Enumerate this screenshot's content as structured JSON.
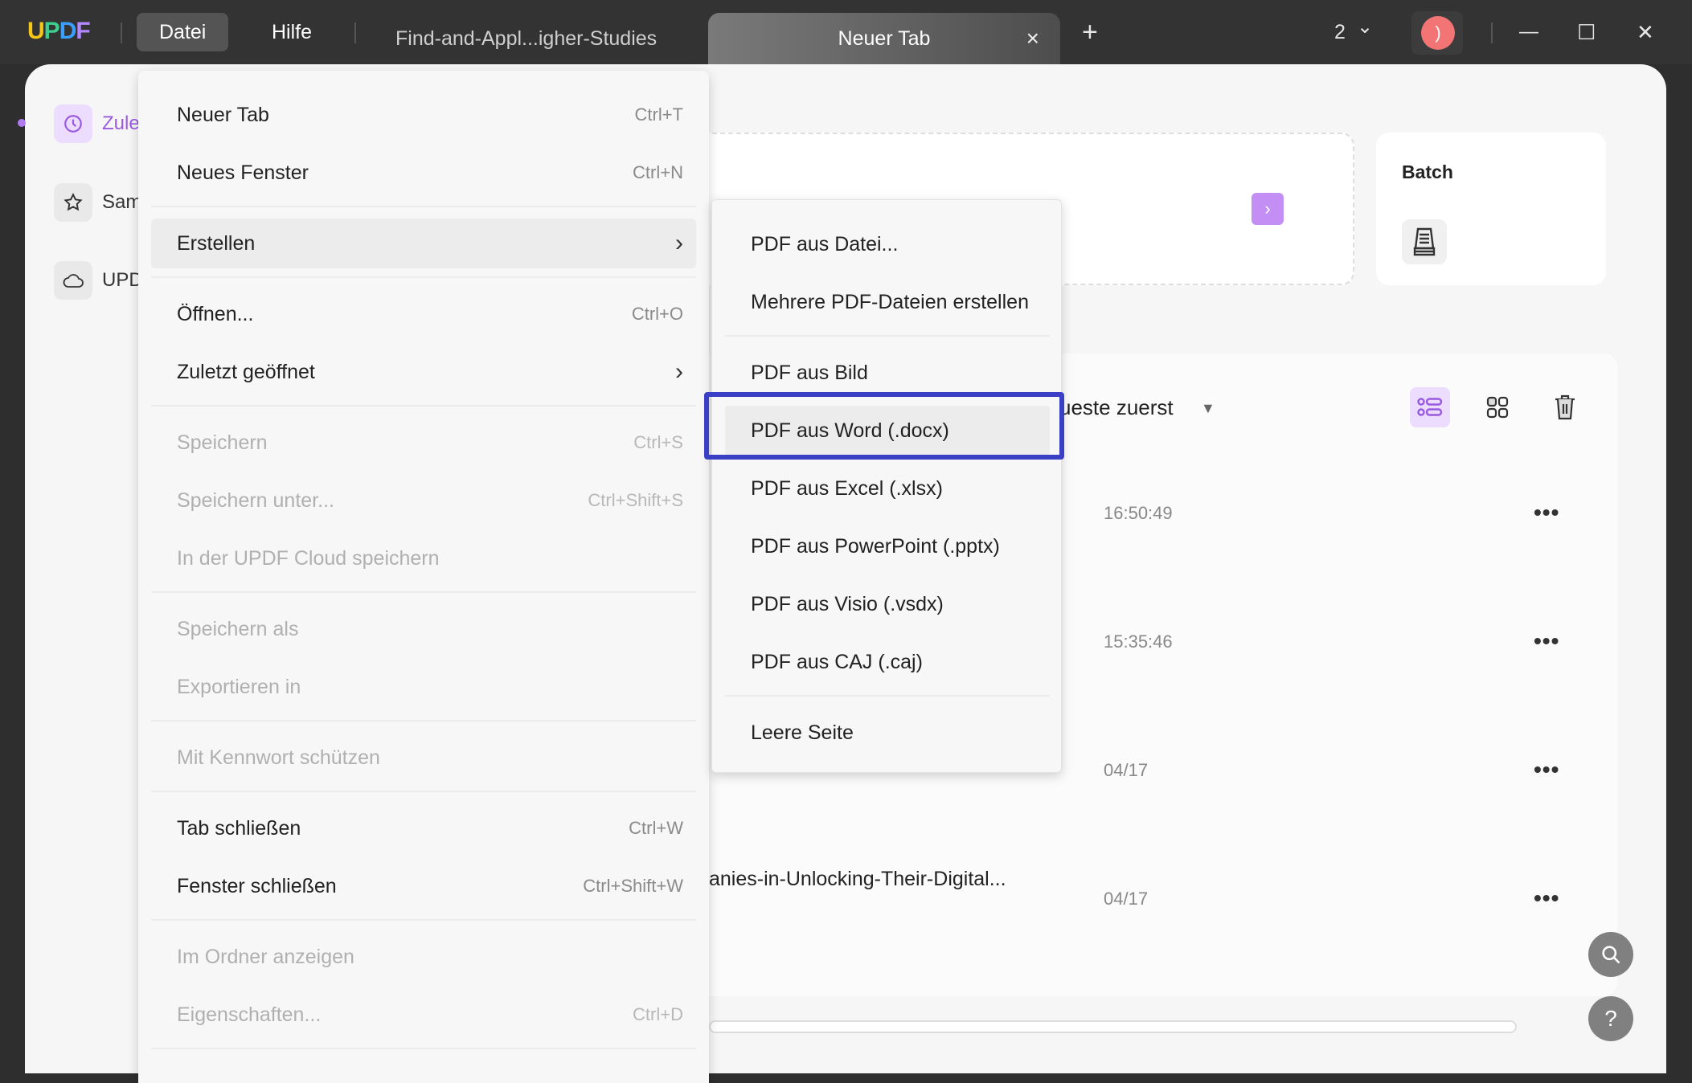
{
  "app": {
    "logo": [
      "U",
      "P",
      "D",
      "F"
    ],
    "menubar": {
      "file": "Datei",
      "help": "Hilfe"
    },
    "tabs": [
      {
        "label": "Find-and-Appl...igher-Studies",
        "active": false
      },
      {
        "label": "Neuer Tab",
        "active": true
      }
    ],
    "tab_close_icon": "×",
    "new_tab_icon": "+",
    "window_count": "2",
    "window_count_chevron": "⌄",
    "avatar_initial": ")",
    "window_controls": {
      "minimize": "—",
      "maximize": "☐",
      "close": "✕"
    }
  },
  "sidebar": {
    "items": [
      {
        "label": "Zule",
        "icon": "clock-icon",
        "active": true
      },
      {
        "label": "Sam",
        "icon": "star-icon",
        "active": false
      },
      {
        "label": "UPD",
        "icon": "cloud-icon",
        "active": false
      }
    ]
  },
  "main": {
    "upload_arrow": "›",
    "batch": {
      "title": "Batch"
    },
    "sort": {
      "label": "ueste zuerst",
      "caret": "▼"
    },
    "files": [
      {
        "name": "",
        "time": "16:50:49",
        "more": "•••"
      },
      {
        "name": "",
        "time": "15:35:46",
        "more": "•••"
      },
      {
        "name": "",
        "time": "04/17",
        "more": "•••"
      },
      {
        "name": "anies-in-Unlocking-Their-Digital...",
        "time": "04/17",
        "more": "•••"
      }
    ],
    "fab_search": "⌕",
    "fab_help": "?"
  },
  "file_menu": {
    "items": [
      {
        "label": "Neuer Tab",
        "shortcut": "Ctrl+T",
        "disabled": false
      },
      {
        "label": "Neues Fenster",
        "shortcut": "Ctrl+N",
        "disabled": false
      },
      {
        "label": "Erstellen",
        "shortcut": "",
        "submenu": true,
        "disabled": false
      },
      {
        "label": "Öffnen...",
        "shortcut": "Ctrl+O",
        "disabled": false
      },
      {
        "label": "Zuletzt geöffnet",
        "shortcut": "",
        "submenu": true,
        "disabled": false
      },
      {
        "label": "Speichern",
        "shortcut": "Ctrl+S",
        "disabled": true
      },
      {
        "label": "Speichern unter...",
        "shortcut": "Ctrl+Shift+S",
        "disabled": true
      },
      {
        "label": "In der UPDF Cloud speichern",
        "shortcut": "",
        "disabled": true
      },
      {
        "label": "Speichern als",
        "shortcut": "",
        "disabled": true
      },
      {
        "label": "Exportieren in",
        "shortcut": "",
        "disabled": true
      },
      {
        "label": "Mit Kennwort schützen",
        "shortcut": "",
        "disabled": true
      },
      {
        "label": "Tab schließen",
        "shortcut": "Ctrl+W",
        "disabled": false
      },
      {
        "label": "Fenster schließen",
        "shortcut": "Ctrl+Shift+W",
        "disabled": false
      },
      {
        "label": "Im Ordner anzeigen",
        "shortcut": "",
        "disabled": true
      },
      {
        "label": "Eigenschaften...",
        "shortcut": "Ctrl+D",
        "disabled": true
      }
    ],
    "chevron": "›"
  },
  "create_submenu": {
    "items": [
      {
        "label": "PDF aus Datei..."
      },
      {
        "label": "Mehrere PDF-Dateien erstellen"
      },
      {
        "label": "PDF aus Bild"
      },
      {
        "label": "PDF aus Word (.docx)",
        "highlighted": true
      },
      {
        "label": "PDF aus Excel (.xlsx)"
      },
      {
        "label": "PDF aus PowerPoint (.pptx)"
      },
      {
        "label": "PDF aus Visio (.vsdx)"
      },
      {
        "label": "PDF aus CAJ (.caj)"
      },
      {
        "label": "Leere Seite"
      }
    ]
  },
  "colors": {
    "accent": "#9a5ae0",
    "highlight_border": "#3b3fc6",
    "avatar": "#f27474"
  }
}
